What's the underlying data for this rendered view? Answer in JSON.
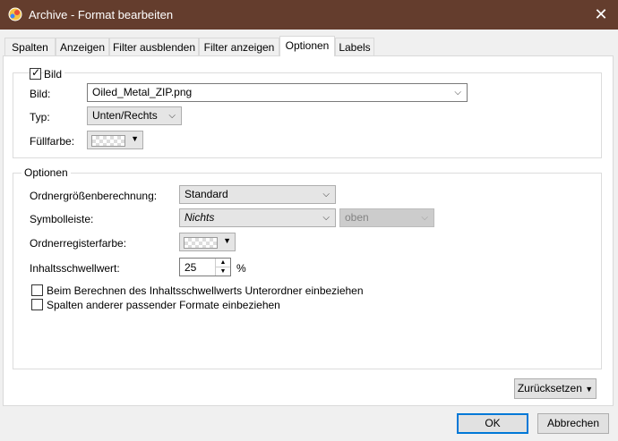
{
  "window": {
    "title": "Archive - Format bearbeiten",
    "close_glyph": "✕"
  },
  "tabs": [
    {
      "label": "Spalten",
      "active": false
    },
    {
      "label": "Anzeigen",
      "active": false
    },
    {
      "label": "Filter ausblenden",
      "active": false
    },
    {
      "label": "Filter anzeigen",
      "active": false
    },
    {
      "label": "Optionen",
      "active": true
    },
    {
      "label": "Labels",
      "active": false
    }
  ],
  "bild_group": {
    "checkbox_label": "Bild",
    "checked": true,
    "bild_label": "Bild:",
    "bild_value": "Oiled_Metal_ZIP.png",
    "typ_label": "Typ:",
    "typ_value": "Unten/Rechts",
    "fill_label": "Füllfarbe:"
  },
  "options_group": {
    "title": "Optionen",
    "size_calc_label": "Ordnergrößenberechnung:",
    "size_calc_value": "Standard",
    "toolbar_label": "Symbolleiste:",
    "toolbar_value": "Nichts",
    "toolbar_position_value": "oben",
    "tab_color_label": "Ordnerregisterfarbe:",
    "threshold_label": "Inhaltsschwellwert:",
    "threshold_value": "25",
    "threshold_unit": "%",
    "include_subfolders_label": "Beim Berechnen des Inhaltsschwellwerts Unterordner einbeziehen",
    "include_subfolders_checked": false,
    "include_columns_label": "Spalten anderer passender Formate einbeziehen",
    "include_columns_checked": false
  },
  "buttons": {
    "reset_label": "Zurücksetzen",
    "ok_label": "OK",
    "cancel_label": "Abbrechen"
  },
  "icons": {
    "app": "archive-app-icon",
    "dropdown": "chevron-down-icon",
    "check": "checkmark-icon"
  }
}
